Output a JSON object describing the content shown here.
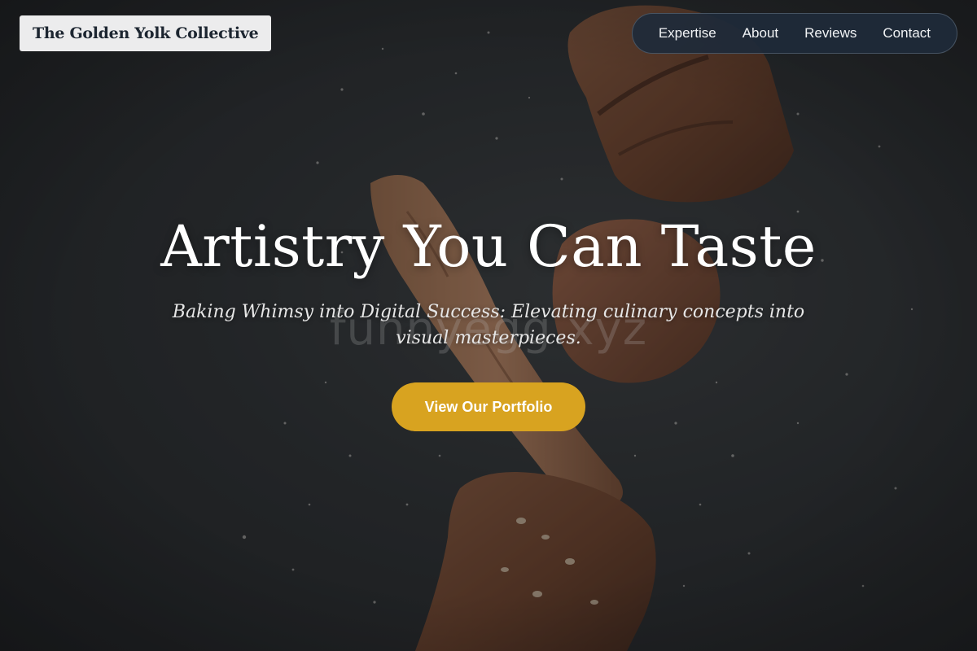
{
  "header": {
    "brand_name": "The Golden Yolk Collective",
    "nav_items": [
      {
        "label": "Expertise"
      },
      {
        "label": "About"
      },
      {
        "label": "Reviews"
      },
      {
        "label": "Contact"
      }
    ]
  },
  "hero": {
    "headline": "Artistry You Can Taste",
    "subheadline": "Baking Whimsy into Digital Success: Elevating culinary concepts into visual masterpieces.",
    "cta_label": "View Our Portfolio",
    "watermark": "funnyegg.xyz",
    "background_image": "falling-bread-loaves-with-flour-dust"
  },
  "colors": {
    "accent": "#d8a320",
    "nav_background": "#1e2a3a",
    "brand_background": "#ececed",
    "background_dark": "#2a2d2f"
  }
}
